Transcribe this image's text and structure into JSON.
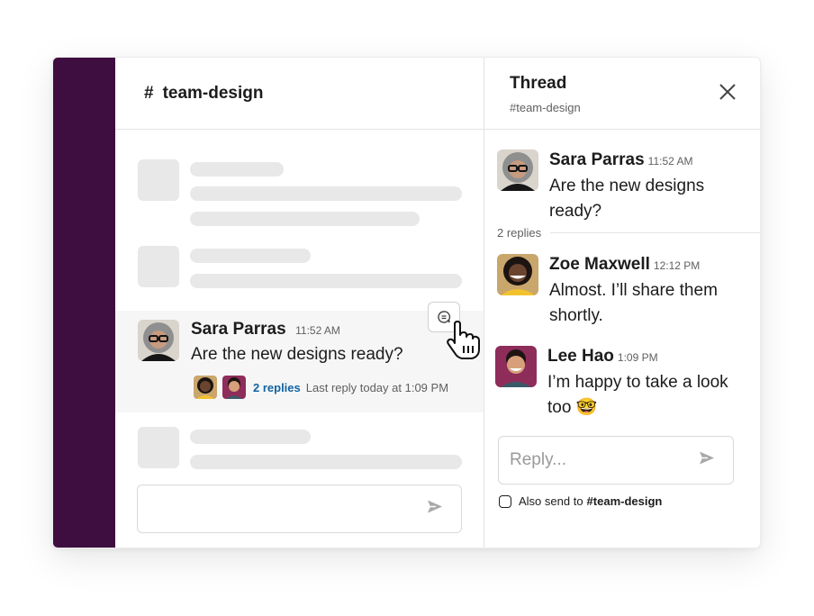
{
  "colors": {
    "sidebar": "#3f0e40",
    "link": "#1264a3",
    "skeleton": "#e8e8e8"
  },
  "channel": {
    "hash": "#",
    "title": "team-design",
    "message": {
      "author": "Sara Parras",
      "time": "11:52 AM",
      "text": "Are the new designs ready?",
      "replies_label": "2 replies",
      "last_reply": "Last reply today at 1:09 PM"
    },
    "composer_placeholder": ""
  },
  "thread": {
    "title": "Thread",
    "subtitle": "#team-design",
    "parent": {
      "author": "Sara Parras",
      "time": "11:52 AM",
      "text": "Are the new designs ready?"
    },
    "replies_count_label": "2 replies",
    "replies": [
      {
        "author": "Zoe Maxwell",
        "time": "12:12 PM",
        "text": "Almost. I’ll share them shortly."
      },
      {
        "author": "Lee Hao",
        "time": "1:09 PM",
        "text": "I’m happy to take a look too 🤓"
      }
    ],
    "reply_placeholder": "Reply...",
    "also_send_label": "Also send to",
    "also_send_channel": "#team-design"
  },
  "icons": {
    "reply_in_thread": "speech-bubble-icon",
    "send": "send-icon",
    "close": "close-icon",
    "cursor": "hand-pointer-icon"
  }
}
